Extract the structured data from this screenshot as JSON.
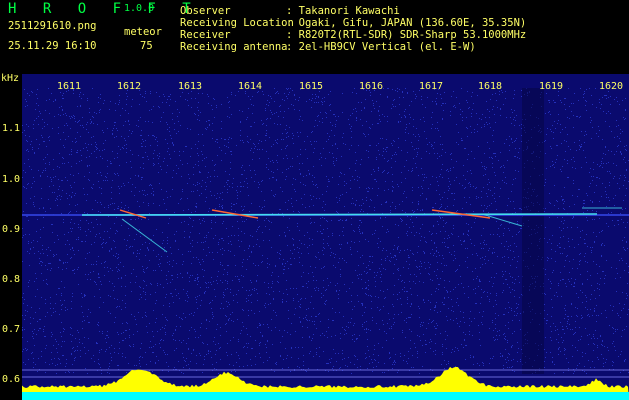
{
  "app": {
    "name": "H R O F F T",
    "version": "1.0.0"
  },
  "file": {
    "name": "2511291610.png",
    "datetime": "25.11.29 16:10"
  },
  "meteor": {
    "label": "meteor",
    "count": "75"
  },
  "info": [
    {
      "key": "Observer",
      "value": ": Takanori Kawachi"
    },
    {
      "key": "Receiving Location",
      "value": ": Ogaki, Gifu, JAPAN (136.60E, 35.35N)"
    },
    {
      "key": "Receiver",
      "value": ": R820T2(RTL-SDR) SDR-Sharp 53.1000MHz"
    },
    {
      "key": "Receiving antenna",
      "value": ": 2el-HB9CV Vertical (el. E-W)"
    }
  ],
  "axis": {
    "y_unit": "kHz",
    "y_ticks": [
      "1.1",
      "1.0",
      "0.9",
      "0.8",
      "0.7",
      "0.6"
    ],
    "x_ticks": [
      "1611",
      "1612",
      "1613",
      "1614",
      "1615",
      "1616",
      "1617",
      "1618",
      "1619",
      "1620"
    ]
  },
  "colors": {
    "background": "#0a0a6e",
    "noise": "#2d3dd6",
    "signal": "#44ddee",
    "histogram": "#ffff00",
    "baseline": "#00ffff"
  }
}
